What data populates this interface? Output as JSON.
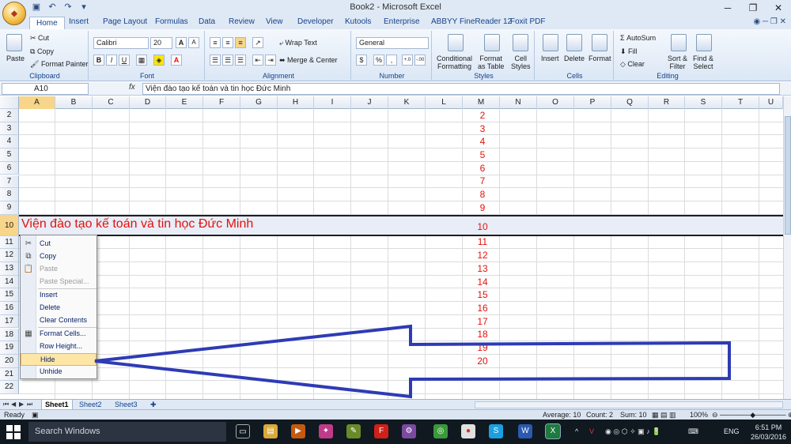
{
  "window": {
    "title": "Book2 - Microsoft Excel"
  },
  "quick_access": [
    "save-icon",
    "undo-icon",
    "redo-icon"
  ],
  "tabs": [
    "Home",
    "Insert",
    "Page Layout",
    "Formulas",
    "Data",
    "Review",
    "View",
    "Developer",
    "Kutools",
    "Enterprise",
    "ABBYY FineReader 12",
    "Foxit PDF"
  ],
  "ribbon": {
    "clipboard": {
      "label": "Clipboard",
      "paste": "Paste",
      "cut": "Cut",
      "copy": "Copy",
      "format_painter": "Format Painter"
    },
    "font": {
      "label": "Font",
      "name": "Calibri",
      "size": "20",
      "grow": "A",
      "shrink": "A",
      "bold": "B",
      "italic": "I",
      "underline": "U",
      "font_color_letter": "A"
    },
    "alignment": {
      "label": "Alignment",
      "wrap_text": "Wrap Text",
      "merge_center": "Merge & Center"
    },
    "number": {
      "label": "Number",
      "format": "General",
      "currency": "$",
      "percent": "%",
      "comma": ",",
      "inc_dec": "+.0",
      "dec_dec": "-.00"
    },
    "styles": {
      "label": "Styles",
      "conditional": [
        "Conditional",
        "Formatting"
      ],
      "format_table": [
        "Format",
        "as Table"
      ],
      "cell_styles": [
        "Cell",
        "Styles"
      ]
    },
    "cells": {
      "label": "Cells",
      "insert": "Insert",
      "delete": "Delete",
      "format": "Format"
    },
    "editing": {
      "label": "Editing",
      "autosum": "AutoSum",
      "fill": "Fill",
      "clear": "Clear",
      "sort_filter": [
        "Sort &",
        "Filter"
      ],
      "find_select": [
        "Find &",
        "Select"
      ]
    }
  },
  "formula_bar": {
    "name_box": "A10",
    "fx": "fx",
    "content": "Viện đào tạo kế toán và tin học Đức Minh"
  },
  "grid": {
    "columns": [
      "A",
      "B",
      "C",
      "D",
      "E",
      "F",
      "G",
      "H",
      "I",
      "J",
      "K",
      "L",
      "M",
      "N",
      "O",
      "P",
      "Q",
      "R",
      "S",
      "T",
      "U"
    ],
    "rows": [
      "2",
      "3",
      "4",
      "5",
      "6",
      "7",
      "8",
      "9",
      "10",
      "11",
      "12",
      "13",
      "14",
      "15",
      "16",
      "17",
      "18",
      "19",
      "20",
      "21",
      "22"
    ],
    "selected_row": "10",
    "selected_column": "A",
    "row10_text": "Viện đào tạo kế toán và tin học Đức Minh",
    "column_m_values": [
      "2",
      "3",
      "4",
      "5",
      "6",
      "7",
      "8",
      "9",
      "10",
      "11",
      "12",
      "13",
      "14",
      "15",
      "16",
      "17",
      "18",
      "19",
      "20"
    ]
  },
  "context_menu": {
    "items": [
      {
        "label": "Cut",
        "icon": "scissors-icon",
        "enabled": true
      },
      {
        "label": "Copy",
        "icon": "copy-icon",
        "enabled": true
      },
      {
        "label": "Paste",
        "icon": "paste-icon",
        "enabled": false
      },
      {
        "label": "Paste Special...",
        "icon": "",
        "enabled": false
      },
      {
        "label": "Insert",
        "icon": "",
        "enabled": true
      },
      {
        "label": "Delete",
        "icon": "",
        "enabled": true
      },
      {
        "label": "Clear Contents",
        "icon": "",
        "enabled": true
      },
      {
        "label": "Format Cells...",
        "icon": "format-cells-icon",
        "enabled": true
      },
      {
        "label": "Row Height...",
        "icon": "",
        "enabled": true
      },
      {
        "label": "Hide",
        "icon": "",
        "enabled": true,
        "highlighted": true
      },
      {
        "label": "Unhide",
        "icon": "",
        "enabled": true
      }
    ]
  },
  "sheets": [
    "Sheet1",
    "Sheet2",
    "Sheet3"
  ],
  "active_sheet": "Sheet1",
  "status": {
    "mode": "Ready",
    "average": "Average: 10",
    "count": "Count: 2",
    "sum": "Sum: 10",
    "zoom": "100%"
  },
  "taskbar": {
    "search_placeholder": "Search Windows",
    "language": "ENG",
    "time": "6:51 PM",
    "date": "26/03/2016"
  },
  "colors": {
    "accent_red": "#e3120b",
    "arrow_blue": "#2e3bb5",
    "selection": "#f7d58a"
  }
}
